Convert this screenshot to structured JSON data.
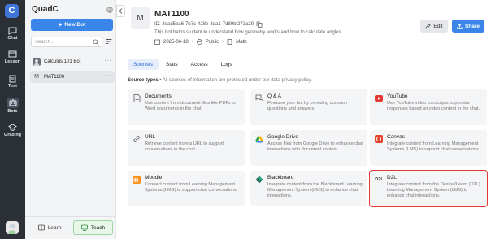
{
  "rail": {
    "logo": "C",
    "items": [
      {
        "label": "Chat"
      },
      {
        "label": "Lesson"
      },
      {
        "label": "Test"
      },
      {
        "label": "Bots"
      },
      {
        "label": "Grading"
      }
    ]
  },
  "sidebar": {
    "brand": "QuadC",
    "new_bot_label": "New Bot",
    "search_placeholder": "Search...",
    "bots": [
      {
        "name": "Calculus 101 Bot"
      },
      {
        "name": "MAT1100",
        "initial": "M"
      }
    ],
    "modes": {
      "learn": "Learn",
      "teach": "Teach"
    }
  },
  "bot": {
    "initial": "M",
    "title": "MAT1100",
    "id": "ID: 3ead5ba6-7b7c-428e-8da1-7d89bf273a29",
    "description": "This bot helps student to understand how geometry works and how to calculate angles",
    "date": "2025-06-18",
    "visibility": "Public",
    "subject": "Math"
  },
  "actions": {
    "edit": "Edit",
    "share": "Share"
  },
  "tabs": [
    {
      "label": "Sources"
    },
    {
      "label": "Stats"
    },
    {
      "label": "Access"
    },
    {
      "label": "Logs"
    }
  ],
  "source_types": {
    "label": "Source types",
    "note": " • All sources of information are protected under our data privacy policy."
  },
  "cards": [
    {
      "title": "Documents",
      "desc": "Use content from document files like PDFs or Word documents in the chat.",
      "icon": "document-icon",
      "color": "#555555"
    },
    {
      "title": "Q & A",
      "desc": "Finetune your bot by providing common questions and answers.",
      "icon": "qa-icon",
      "color": "#555555"
    },
    {
      "title": "YouTube",
      "desc": "Use YouTube video transcripts to provide responses based on video content in the chat.",
      "icon": "youtube-icon",
      "color": "#e53935"
    },
    {
      "title": "URL",
      "desc": "Retrieve content from a URL to support conversations in the chat.",
      "icon": "link-icon",
      "color": "#555555"
    },
    {
      "title": "Google Drive",
      "desc": "Access files from Google Drive to enhance chat interactions with document content.",
      "icon": "google-drive-icon",
      "color": "#34a853"
    },
    {
      "title": "Canvas",
      "desc": "Integrate content from Learning Management Systems (LMS) to support chat conversations.",
      "icon": "canvas-icon",
      "color": "#e2412d"
    },
    {
      "title": "Moodle",
      "desc": "Connect content from Learning Management Systems (LMS) to support chat conversations.",
      "icon": "moodle-icon",
      "color": "#f7931e"
    },
    {
      "title": "Blackboard",
      "desc": "Integrate content from the Blackboard Learning Management System (LMS) to enhance chat interactions.",
      "icon": "blackboard-icon",
      "color": "#1f6f5a"
    },
    {
      "title": "D2L",
      "desc": "Integrate content from the Desire2Learn (D2L) Learning Management System (LMS) to enhance chat interactions.",
      "icon": "d2l-icon",
      "icon_text": "D2L",
      "color": "#333333"
    }
  ]
}
